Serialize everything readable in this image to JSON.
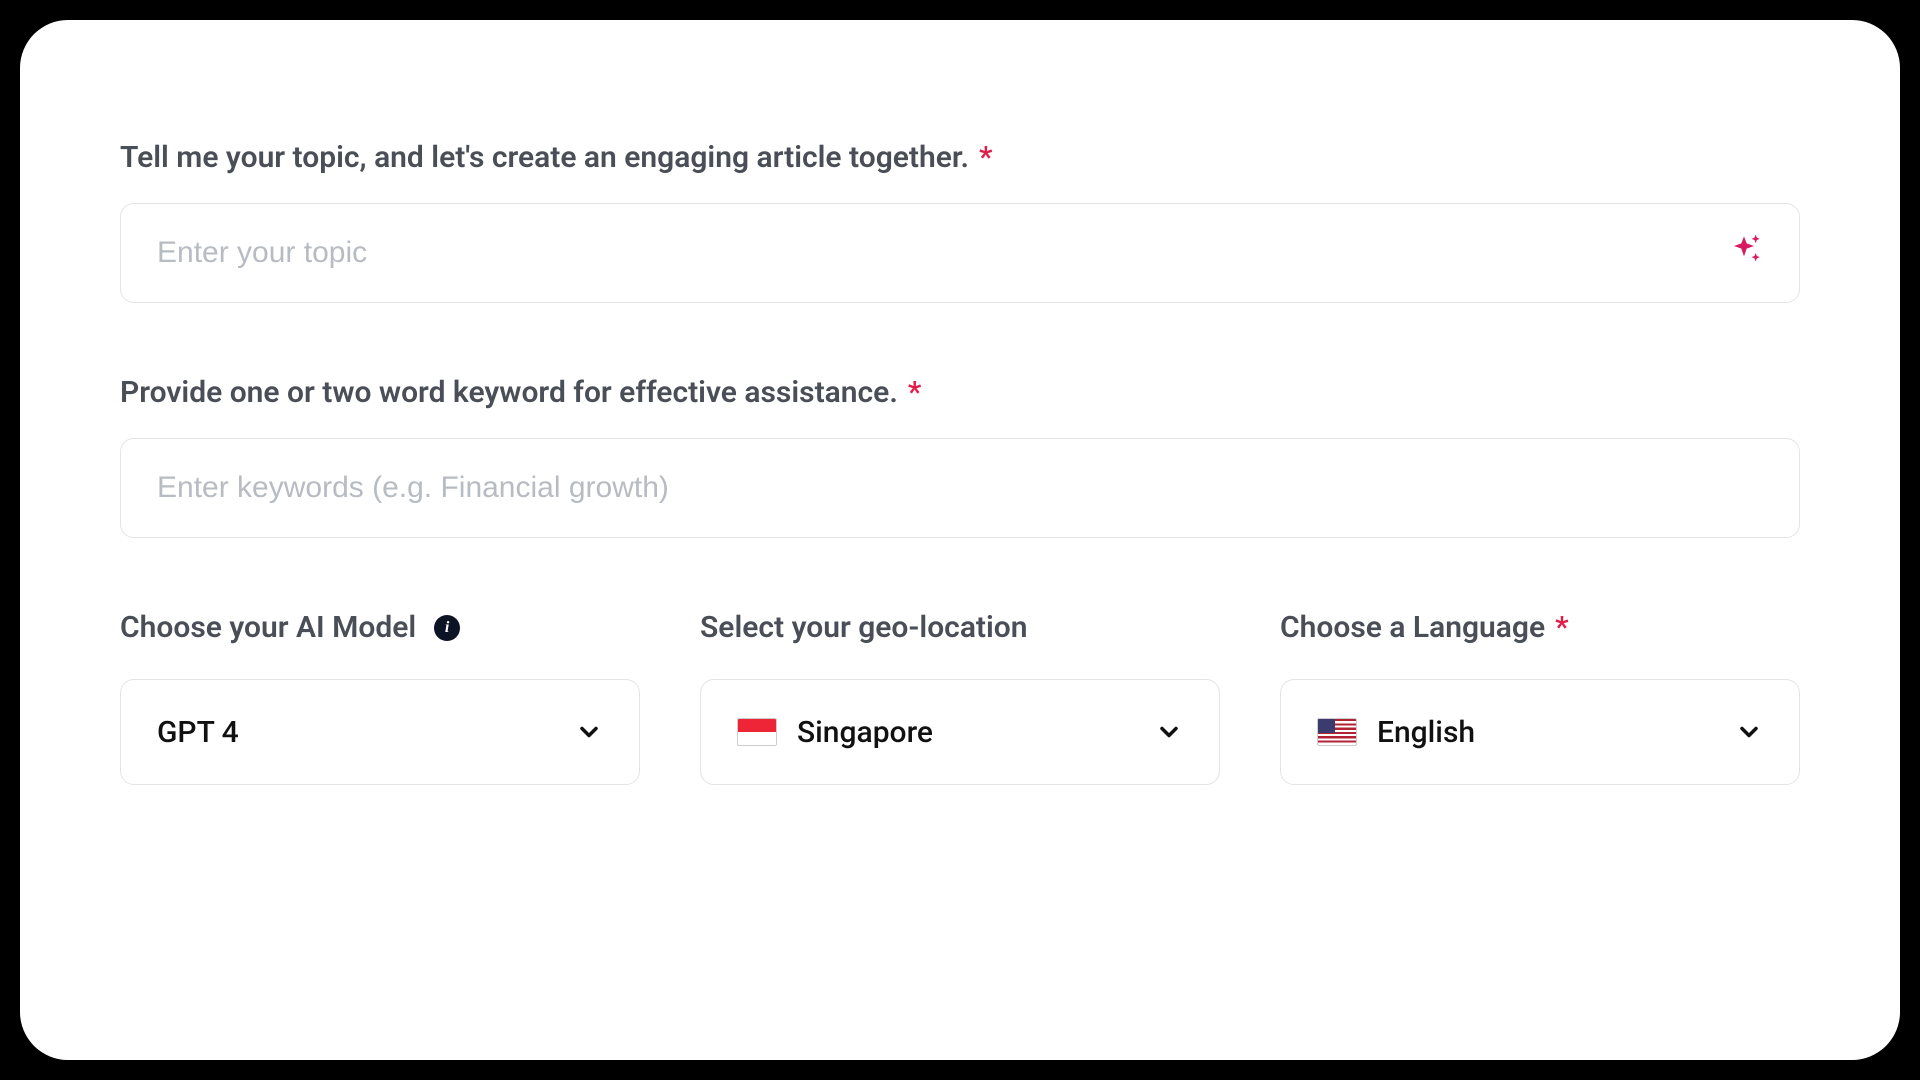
{
  "topic": {
    "label": "Tell me your topic, and let's create an engaging article together.",
    "required_marker": "*",
    "placeholder": "Enter your topic",
    "value": ""
  },
  "keyword": {
    "label": "Provide one or two word keyword for effective assistance.",
    "required_marker": "*",
    "placeholder": "Enter keywords (e.g. Financial growth)",
    "value": ""
  },
  "model": {
    "label": "Choose your AI Model",
    "info": "i",
    "selected": "GPT 4"
  },
  "geo": {
    "label": "Select your geo-location",
    "selected": "Singapore"
  },
  "language": {
    "label": "Choose a Language",
    "required_marker": "*",
    "selected": "English"
  },
  "colors": {
    "required": "#e11d48",
    "sparkle": "#d81b60"
  }
}
